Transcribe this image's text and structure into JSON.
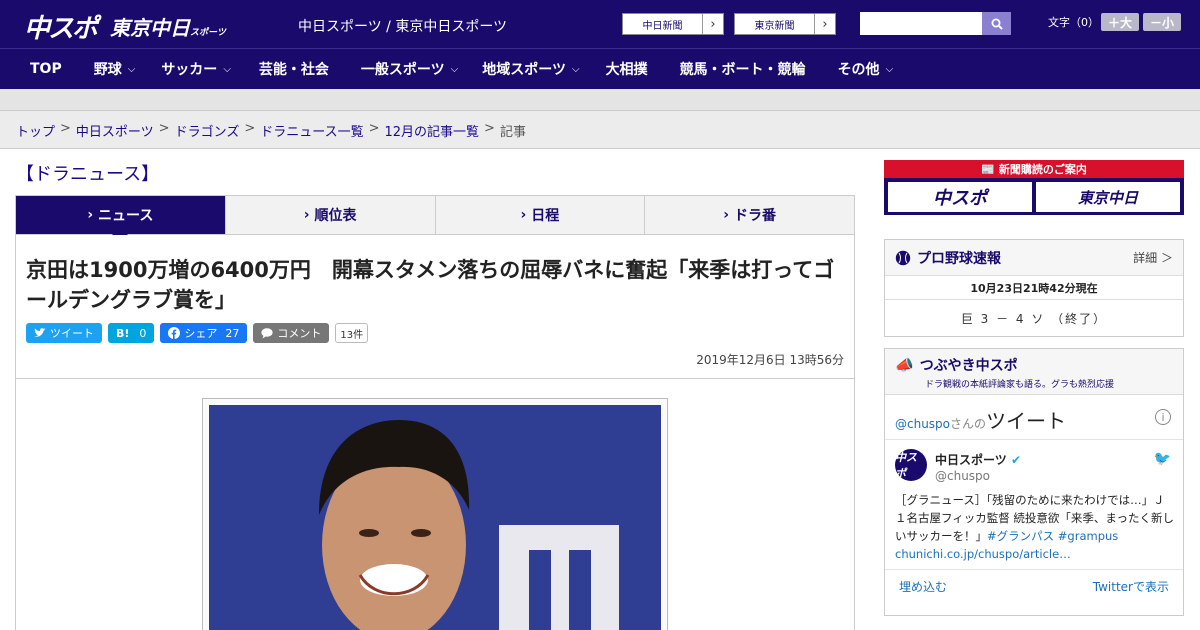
{
  "header": {
    "logo_chuspo": "中スポ",
    "logo_tokyo": "東京中日",
    "logo_tokyo_small": "スポーツ",
    "site_name": "中日スポーツ / 東京中日スポーツ",
    "ext_links": [
      "中日新聞",
      "東京新聞"
    ],
    "font_size_label": "文字（0）",
    "font_plus": "＋大",
    "font_minus": "－小"
  },
  "nav": {
    "items": [
      {
        "label": "TOP",
        "chevron": false
      },
      {
        "label": "野球",
        "chevron": true
      },
      {
        "label": "サッカー",
        "chevron": true
      },
      {
        "label": "芸能・社会",
        "chevron": false
      },
      {
        "label": "一般スポーツ",
        "chevron": true
      },
      {
        "label": "地域スポーツ",
        "chevron": true
      },
      {
        "label": "大相撲",
        "chevron": false
      },
      {
        "label": "競馬・ボート・競輪",
        "chevron": false
      },
      {
        "label": "その他",
        "chevron": true
      }
    ]
  },
  "breadcrumb": {
    "links": [
      "トップ",
      "中日スポーツ",
      "ドラゴンズ",
      "ドラニュース一覧",
      "12月の記事一覧"
    ],
    "current": "記事"
  },
  "section_title": "【ドラニュース】",
  "tabs": [
    "ニュース",
    "順位表",
    "日程",
    "ドラ番"
  ],
  "article": {
    "headline": "京田は1900万増の6400万円　開幕スタメン落ちの屈辱バネに奮起「来季は打ってゴールデングラブ賞を」",
    "tweet_label": "ツイート",
    "hatena_label": "B!",
    "hatena_count": "0",
    "fb_label": "シェア",
    "fb_count": "27",
    "comment_label": "コメント",
    "comment_count": "13件",
    "date": "2019年12月6日 13時56分"
  },
  "sidebar": {
    "subscribe_head": "新聞購読のご案内",
    "sub_chuspo": "中スポ",
    "sub_tokyo": "東京中日",
    "baseball_title": "プロ野球速報",
    "baseball_more": "詳細 ＞",
    "baseball_time": "10月23日21時42分現在",
    "baseball_score": "巨 3 － 4 ソ （終了）",
    "tweets_title": "つぶやき中スポ",
    "tweets_sub": "ドラ観戦の本紙評論家も語る。グラも熱烈応援",
    "tw_account": "@chuspo",
    "tw_account_suffix": "さんの",
    "tw_big": "ツイート",
    "tw_name": "中日スポーツ",
    "tw_handle": "@chuspo",
    "tw_text": "［グラニュース］「残留のために来たわけでは…」Ｊ１名古屋フィッカ監督 続投意欲「来季、まったく新しいサッカーを！」",
    "tw_tags": "#グランパス #grampus",
    "tw_link": "chunichi.co.jp/chuspo/article…",
    "tw_embed": "埋め込む",
    "tw_view": "Twitterで表示"
  }
}
